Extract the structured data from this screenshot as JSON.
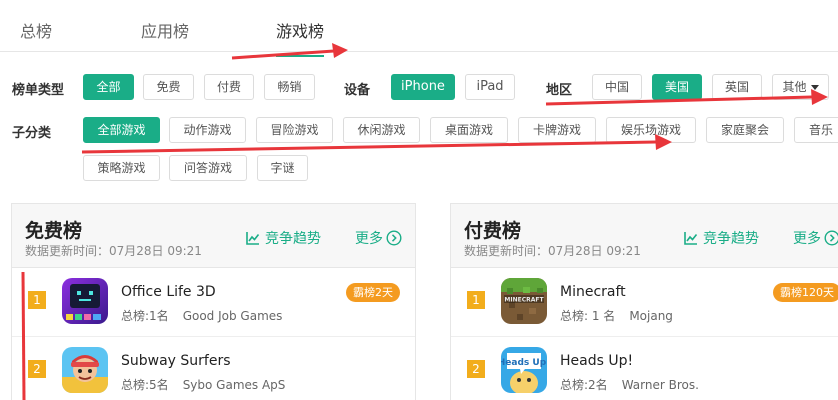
{
  "tabs": [
    {
      "label": "总榜"
    },
    {
      "label": "应用榜"
    },
    {
      "label": "游戏榜"
    }
  ],
  "filters": {
    "list_type": {
      "label": "榜单类型",
      "options": [
        "全部",
        "免费",
        "付费",
        "畅销"
      ],
      "selected": "全部"
    },
    "device": {
      "label": "设备",
      "options": [
        "iPhone",
        "iPad"
      ],
      "selected": "iPhone"
    },
    "region": {
      "label": "地区",
      "options": [
        "中国",
        "美国",
        "英国"
      ],
      "selected": "美国",
      "more": "其他"
    },
    "subcategory": {
      "label": "子分类",
      "options": [
        "全部游戏",
        "动作游戏",
        "冒险游戏",
        "休闲游戏",
        "桌面游戏",
        "卡牌游戏",
        "娱乐场游戏",
        "家庭聚会",
        "音乐",
        "策略游戏",
        "问答游戏",
        "字谜"
      ],
      "selected": "全部游戏"
    }
  },
  "free_panel": {
    "title": "免费榜",
    "updated": "数据更新时间：07月28日 09:21",
    "trend_label": "竞争趋势",
    "more_label": "更多",
    "apps": [
      {
        "rank": "1",
        "name": "Office Life 3D",
        "overall": "总榜:1名",
        "developer": "Good Job Games",
        "badge": "霸榜2天",
        "icon": "office-life-3d-icon"
      },
      {
        "rank": "2",
        "name": "Subway Surfers",
        "overall": "总榜:5名",
        "developer": "Sybo Games ApS",
        "badge": "",
        "icon": "subway-surfers-icon"
      }
    ]
  },
  "paid_panel": {
    "title": "付费榜",
    "updated": "数据更新时间：07月28日 09:21",
    "trend_label": "竞争趋势",
    "more_label": "更多",
    "apps": [
      {
        "rank": "1",
        "name": "Minecraft",
        "overall": "总榜: 1 名",
        "developer": "Mojang",
        "badge": "霸榜120天",
        "icon": "minecraft-icon"
      },
      {
        "rank": "2",
        "name": "Heads Up!",
        "overall": "总榜:2名",
        "developer": "Warner Bros.",
        "badge": "",
        "icon": "heads-up-icon"
      }
    ]
  },
  "colors": {
    "accent": "#1aad87",
    "rank_badge": "#f2ad1c",
    "streak_badge": "#f49b20",
    "annotation": "#e8363b"
  }
}
